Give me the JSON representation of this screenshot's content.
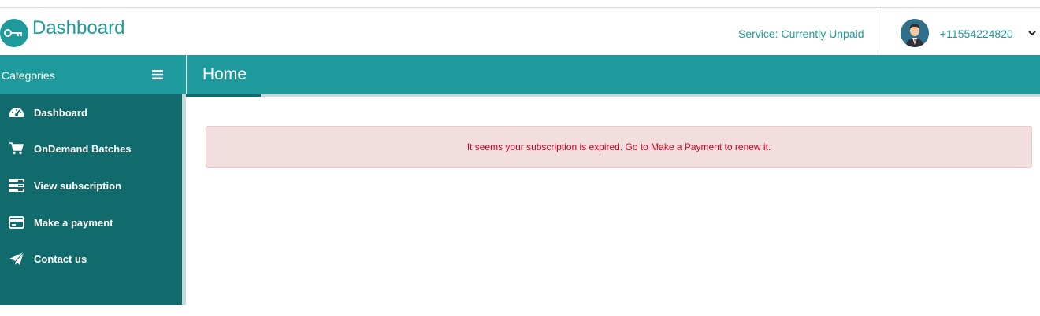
{
  "header": {
    "brand": "Dashboard",
    "service_status": "Service: Currently Unpaid",
    "phone": "+11554224820",
    "logo_icon": "key-icon",
    "avatar_icon": "user-avatar-icon",
    "caret_icon": "chevron-down-icon"
  },
  "sidebar": {
    "title": "Categories",
    "menu_icon": "hamburger-icon",
    "items": [
      {
        "label": "Dashboard",
        "icon": "speedometer-icon"
      },
      {
        "label": "OnDemand Batches",
        "icon": "cart-icon"
      },
      {
        "label": "View subscription",
        "icon": "list-icon"
      },
      {
        "label": "Make a payment",
        "icon": "credit-card-icon"
      },
      {
        "label": "Contact us",
        "icon": "paper-plane-icon"
      }
    ]
  },
  "main": {
    "title": "Home",
    "alert": "It seems your subscription is expired. Go to Make a Payment to renew it."
  },
  "colors": {
    "primary": "#1f9a9c",
    "sidebar": "#116b6c",
    "alert_bg": "#f2dede",
    "alert_text": "#d0021b"
  }
}
